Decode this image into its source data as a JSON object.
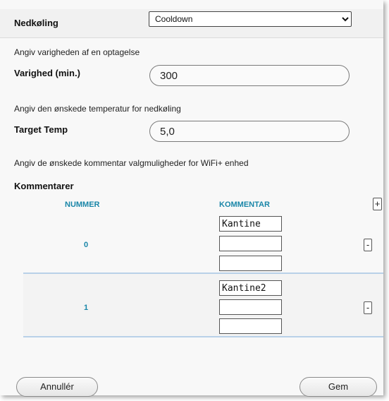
{
  "cooldown": {
    "label": "Nedkøling",
    "selected": "Cooldown"
  },
  "duration": {
    "description": "Angiv varigheden af en optagelse",
    "label": "Varighed (min.)",
    "value": "300"
  },
  "temperature": {
    "description": "Angiv den ønskede temperatur for nedkøling",
    "label": "Target Temp",
    "value": "5,0"
  },
  "comments": {
    "description": "Angiv de ønskede kommentar valgmuligheder for WiFi+ enhed",
    "label": "Kommentarer",
    "col_number": "NUMMER",
    "col_comment": "KOMMENTAR",
    "add_label": "+",
    "remove_label": "-",
    "rows": [
      {
        "number": "0",
        "values": [
          "Kantine",
          "",
          ""
        ]
      },
      {
        "number": "1",
        "values": [
          "Kantine2",
          "",
          ""
        ]
      }
    ]
  },
  "footer": {
    "cancel_label": "Annullér",
    "save_label": "Gem"
  }
}
